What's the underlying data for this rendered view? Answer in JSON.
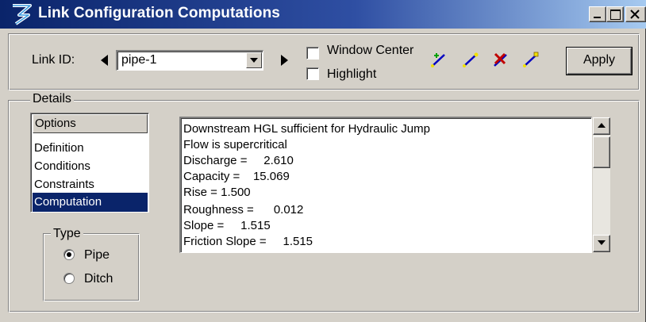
{
  "window": {
    "title": "Link Configuration Computations"
  },
  "toolbar": {
    "link_id_label": "Link ID:",
    "link_id_value": "pipe-1",
    "window_center_label": "Window Center",
    "window_center_checked": false,
    "highlight_label": "Highlight",
    "highlight_checked": false,
    "apply_label": "Apply",
    "tools": [
      "add-link-icon",
      "identify-link-icon",
      "delete-link-icon",
      "edit-link-icon"
    ]
  },
  "details": {
    "title": "Details",
    "options_header": "Options",
    "options": [
      "Definition",
      "Conditions",
      "Constraints",
      "Computation"
    ],
    "selected_option": "Computation",
    "type": {
      "title": "Type",
      "options": [
        "Pipe",
        "Ditch"
      ],
      "selected": "Pipe"
    },
    "results": [
      "Downstream HGL sufficient for Hydraulic Jump",
      "Flow is supercritical",
      "Discharge =     2.610",
      "Capacity =    15.069",
      "Rise = 1.500",
      "Roughness =      0.012",
      "Slope =     1.515",
      "Friction Slope =     1.515"
    ]
  },
  "colors": {
    "titlebar_start": "#0a246a",
    "titlebar_end": "#a6caf0",
    "face": "#d4d0c8",
    "selection": "#0a246a"
  }
}
